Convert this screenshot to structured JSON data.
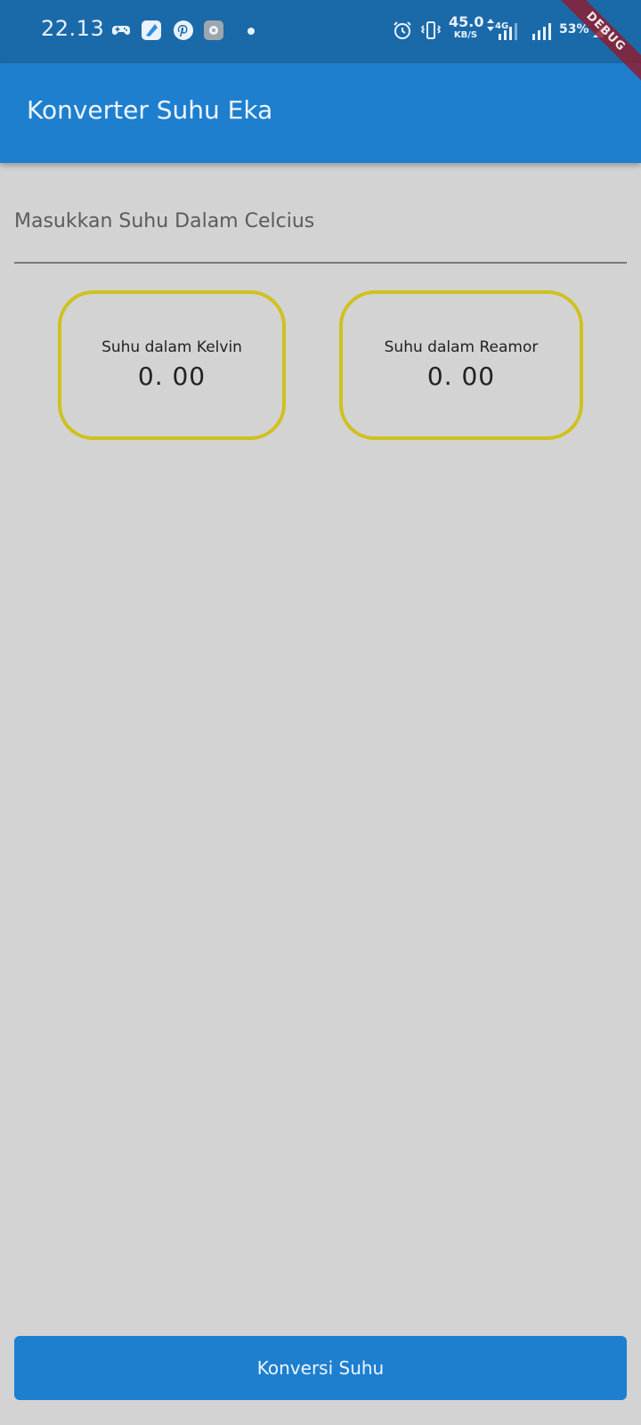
{
  "status_bar": {
    "time": "22.13",
    "speed_value": "45.0",
    "speed_unit": "KB/S",
    "network_type": "4G",
    "battery_percent": "53%",
    "icons": [
      "gamepad-icon",
      "app-icon",
      "pinterest-icon",
      "settings-app-icon",
      "notification-dot-icon",
      "alarm-icon",
      "vibrate-icon",
      "data-arrows-icon",
      "signal-icon",
      "battery-icon"
    ]
  },
  "debug_banner": "DEBUG",
  "app_bar": {
    "title": "Konverter Suhu Eka"
  },
  "input": {
    "placeholder": "Masukkan Suhu Dalam Celcius",
    "value": ""
  },
  "results": {
    "kelvin": {
      "label": "Suhu dalam Kelvin",
      "value": "0. 00"
    },
    "reamur": {
      "label": "Suhu dalam Reamor",
      "value": "0. 00"
    }
  },
  "convert_button": {
    "label": "Konversi Suhu"
  },
  "colors": {
    "status_bar": "#1a6aaa",
    "app_bar": "#1e7fcf",
    "background": "#d3d3d3",
    "card_border": "#cfc11e",
    "button": "#1e7fcf"
  }
}
